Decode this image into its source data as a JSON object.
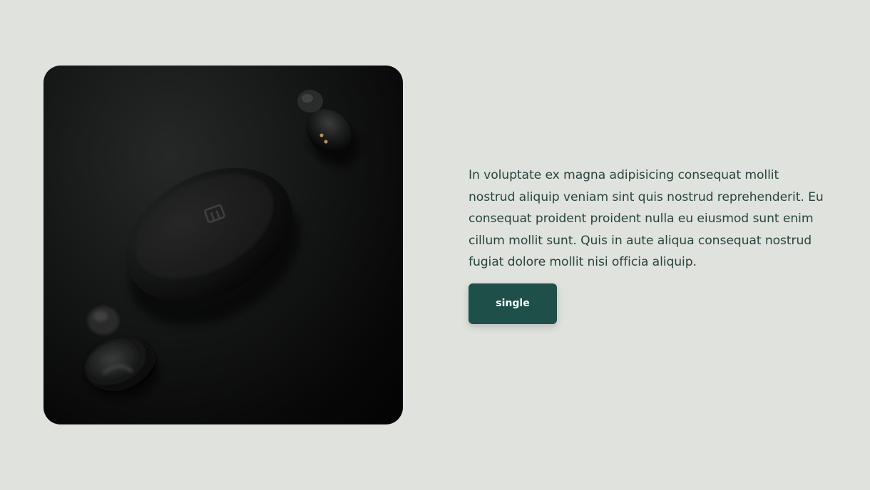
{
  "hero": {
    "image": {
      "subject": "black wireless earbuds with charging case on dark background",
      "icon": "earbuds-product-photo"
    },
    "description": "In voluptate ex magna adipisicing consequat mollit nostrud aliquip veniam sint quis nostrud reprehenderit. Eu consequat proident proident nulla eu eiusmod sunt enim cillum mollit sunt. Quis in aute aliqua consequat nostrud fugiat dolore mollit nisi officia aliquip.",
    "button_label": "single"
  },
  "colors": {
    "background": "#e0e2dd",
    "text": "#28443f",
    "button": "#1e4f48",
    "button_text": "#ffffff"
  }
}
